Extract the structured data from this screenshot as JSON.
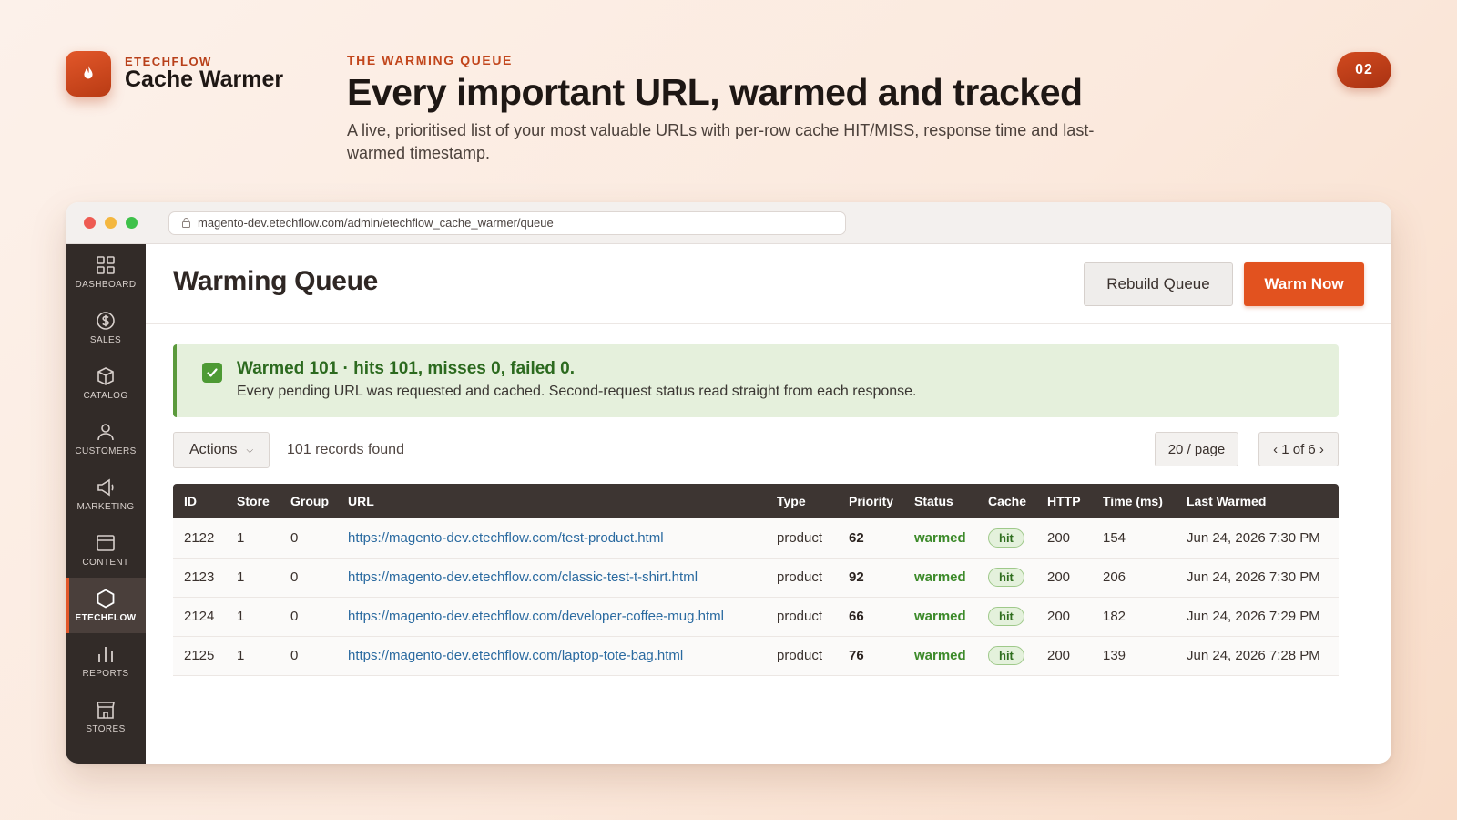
{
  "brand": {
    "eyebrow": "ETECHFLOW",
    "name": "Cache Warmer"
  },
  "hero": {
    "eyebrow": "THE WARMING QUEUE",
    "title": "Every important URL, warmed and tracked",
    "subtitle": "A live, prioritised list of your most valuable URLs with per-row cache HIT/MISS, response time and last-warmed timestamp."
  },
  "page_number": "02",
  "browser": {
    "url": "magento-dev.etechflow.com/admin/etechflow_cache_warmer/queue"
  },
  "sidebar": {
    "items": [
      {
        "label": "DASHBOARD",
        "icon": "grid-icon"
      },
      {
        "label": "SALES",
        "icon": "dollar-icon"
      },
      {
        "label": "CATALOG",
        "icon": "box-icon"
      },
      {
        "label": "CUSTOMERS",
        "icon": "user-icon"
      },
      {
        "label": "MARKETING",
        "icon": "megaphone-icon"
      },
      {
        "label": "CONTENT",
        "icon": "layout-icon"
      },
      {
        "label": "ETECHFLOW",
        "icon": "hexagon-icon",
        "active": true
      },
      {
        "label": "REPORTS",
        "icon": "bar-chart-icon"
      },
      {
        "label": "STORES",
        "icon": "store-icon"
      }
    ]
  },
  "main": {
    "title": "Warming Queue",
    "rebuild_label": "Rebuild Queue",
    "warm_label": "Warm Now"
  },
  "notice": {
    "title": "Warmed 101 · hits 101, misses 0, failed 0.",
    "text": "Every pending URL was requested and cached. Second-request status read straight from each response."
  },
  "toolbar": {
    "actions_label": "Actions",
    "records": "101 records found",
    "per_page": "20 / page",
    "pager": "‹ 1 of 6 ›"
  },
  "table": {
    "columns": [
      "ID",
      "Store",
      "Group",
      "URL",
      "Type",
      "Priority",
      "Status",
      "Cache",
      "HTTP",
      "Time (ms)",
      "Last Warmed"
    ],
    "rows": [
      [
        "2122",
        "1",
        "0",
        "https://magento-dev.etechflow.com/test-product.html",
        "product",
        "62",
        "warmed",
        "hit",
        "200",
        "154",
        "Jun 24, 2026 7:30 PM"
      ],
      [
        "2123",
        "1",
        "0",
        "https://magento-dev.etechflow.com/classic-test-t-shirt.html",
        "product",
        "92",
        "warmed",
        "hit",
        "200",
        "206",
        "Jun 24, 2026 7:30 PM"
      ],
      [
        "2124",
        "1",
        "0",
        "https://magento-dev.etechflow.com/developer-coffee-mug.html",
        "product",
        "66",
        "warmed",
        "hit",
        "200",
        "182",
        "Jun 24, 2026 7:29 PM"
      ],
      [
        "2125",
        "1",
        "0",
        "https://magento-dev.etechflow.com/laptop-tote-bag.html",
        "product",
        "76",
        "warmed",
        "hit",
        "200",
        "139",
        "Jun 24, 2026 7:28 PM"
      ]
    ]
  },
  "colors": {
    "accent": "#e2521f",
    "sidebar": "#322b28",
    "success": "#3c8a2a",
    "link": "#2a6aa0"
  }
}
